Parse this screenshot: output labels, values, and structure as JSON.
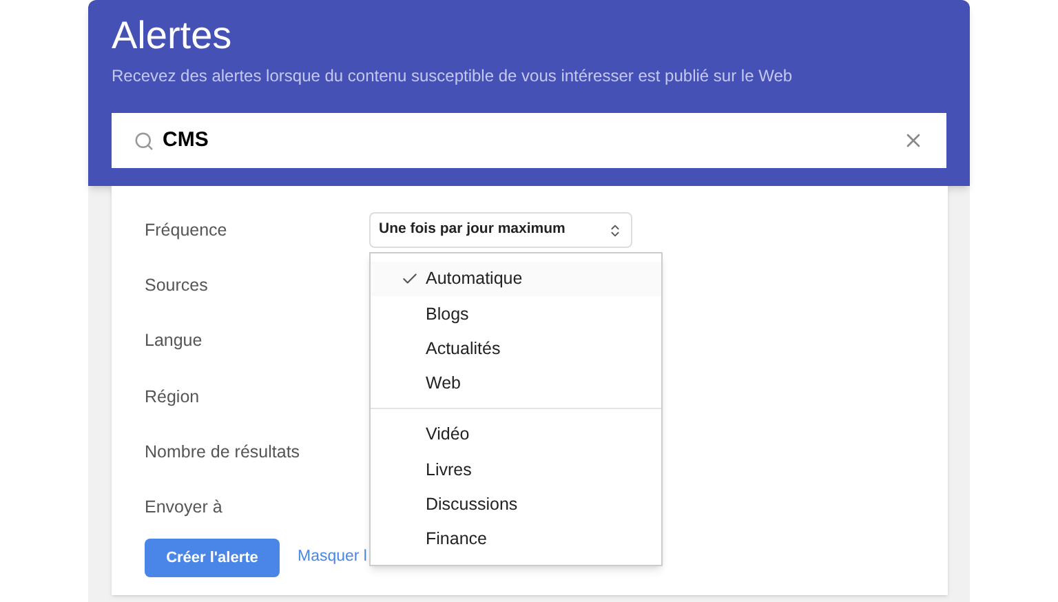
{
  "header": {
    "title": "Alertes",
    "subtitle": "Recevez des alertes lorsque du contenu susceptible de vous intéresser est publié sur le Web"
  },
  "search": {
    "value": "CMS"
  },
  "form": {
    "rows": [
      {
        "label": "Fréquence",
        "select": "Une fois par jour maximum"
      },
      {
        "label": "Sources"
      },
      {
        "label": "Langue"
      },
      {
        "label": "Région"
      },
      {
        "label": "Nombre de résultats"
      },
      {
        "label": "Envoyer à"
      }
    ],
    "create_button": "Créer l'alerte",
    "link": "Masquer l"
  },
  "dropdown": {
    "groups": [
      [
        {
          "label": "Automatique",
          "selected": true
        },
        {
          "label": "Blogs",
          "selected": false
        },
        {
          "label": "Actualités",
          "selected": false
        },
        {
          "label": "Web",
          "selected": false
        }
      ],
      [
        {
          "label": "Vidéo",
          "selected": false
        },
        {
          "label": "Livres",
          "selected": false
        },
        {
          "label": "Discussions",
          "selected": false
        },
        {
          "label": "Finance",
          "selected": false
        }
      ]
    ]
  }
}
